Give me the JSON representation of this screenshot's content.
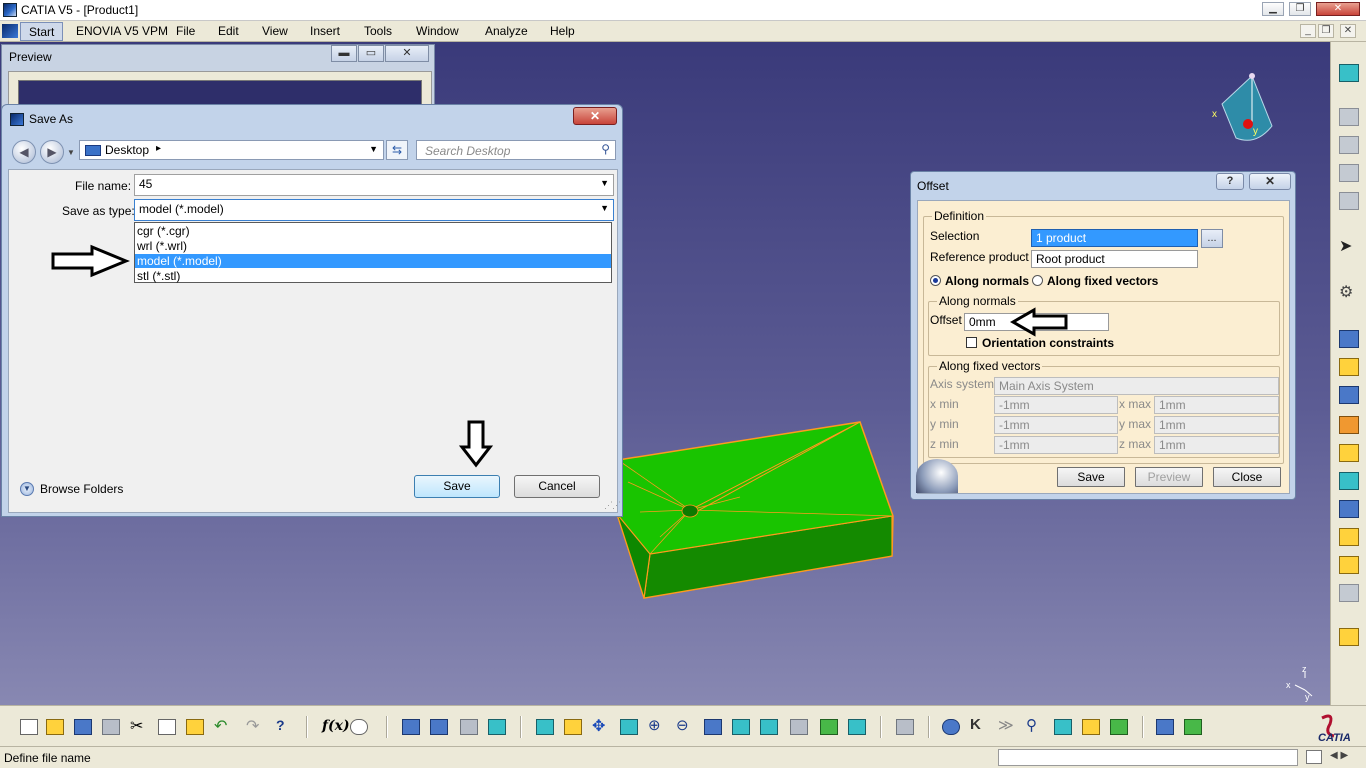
{
  "window": {
    "title": "CATIA V5 - [Product1]",
    "minimize": "▁",
    "restore": "❐",
    "close": "✕"
  },
  "menubar": {
    "items": [
      "Start",
      "ENOVIA V5 VPM",
      "File",
      "Edit",
      "View",
      "Insert",
      "Tools",
      "Window",
      "Analyze",
      "Help"
    ],
    "doc_min": "_",
    "doc_restore": "❐",
    "doc_close": "✕"
  },
  "preview": {
    "title": "Preview",
    "min": "▬",
    "restore": "▭",
    "close": "✕"
  },
  "save_as": {
    "title": "Save As",
    "close": "✕",
    "location": "Desktop",
    "location_arrow": "▸",
    "search_placeholder": "Search Desktop",
    "file_name_label": "File name:",
    "file_name_value": "45",
    "save_type_label": "Save as type:",
    "save_type_value": "model (*.model)",
    "type_options": [
      "cgr (*.cgr)",
      "wrl (*.wrl)",
      "model (*.model)",
      "stl (*.stl)"
    ],
    "selected_option_index": 2,
    "browse_label": "Browse Folders",
    "save_button": "Save",
    "cancel_button": "Cancel"
  },
  "offset": {
    "title": "Offset",
    "help": "?",
    "close": "✕",
    "definition_label": "Definition",
    "selection_label": "Selection",
    "selection_value": "1 product",
    "selection_more": "...",
    "reference_label": "Reference product",
    "reference_value": "Root product",
    "radio_normals": "Along normals",
    "radio_fixed": "Along fixed vectors",
    "radio_selected": "Along normals",
    "normals_group": "Along normals",
    "offset_label": "Offset",
    "offset_value": "0mm",
    "orientation_label": "Orientation constraints",
    "orientation_checked": false,
    "fixed_group": "Along fixed vectors",
    "axis_label": "Axis system",
    "axis_value": "Main Axis System",
    "x_min_label": "x min",
    "x_min": "-1mm",
    "x_max_label": "x max",
    "x_max": "1mm",
    "y_min_label": "y min",
    "y_min": "-1mm",
    "y_max_label": "y max",
    "y_max": "1mm",
    "z_min_label": "z min",
    "z_min": "-1mm",
    "z_max_label": "z max",
    "z_max": "1mm",
    "save_button": "Save",
    "preview_button": "Preview",
    "close_button": "Close"
  },
  "compass": {
    "x_label": "x",
    "y_label": "y",
    "z_label": "z"
  },
  "status": {
    "text": "Define file name"
  },
  "brand": "CATIA",
  "colors": {
    "part_green": "#19c400",
    "part_edge": "#ff9a1e",
    "background_top": "#3a3a7a",
    "selection_blue": "#3399ff"
  }
}
